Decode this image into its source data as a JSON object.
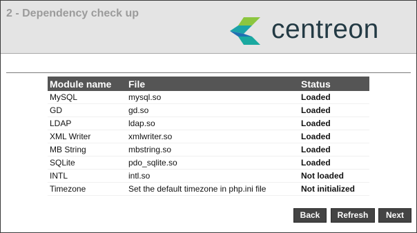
{
  "header": {
    "step_title": "2 - Dependency check up",
    "logo_text": "centreon"
  },
  "table": {
    "columns": [
      "Module name",
      "File",
      "Status"
    ],
    "rows": [
      {
        "module": "MySQL",
        "file": "mysql.so",
        "status": "Loaded",
        "state": "ok"
      },
      {
        "module": "GD",
        "file": "gd.so",
        "status": "Loaded",
        "state": "ok"
      },
      {
        "module": "LDAP",
        "file": "ldap.so",
        "status": "Loaded",
        "state": "ok"
      },
      {
        "module": "XML Writer",
        "file": "xmlwriter.so",
        "status": "Loaded",
        "state": "ok"
      },
      {
        "module": "MB String",
        "file": "mbstring.so",
        "status": "Loaded",
        "state": "ok"
      },
      {
        "module": "SQLite",
        "file": "pdo_sqlite.so",
        "status": "Loaded",
        "state": "ok"
      },
      {
        "module": "INTL",
        "file": "intl.so",
        "status": "Not loaded",
        "state": "bad"
      },
      {
        "module": "Timezone",
        "file": "Set the default timezone in php.ini file",
        "status": "Not initialized",
        "state": "bad"
      }
    ]
  },
  "buttons": {
    "back": "Back",
    "refresh": "Refresh",
    "next": "Next"
  },
  "colors": {
    "ok": "#19b419",
    "bad": "#ee1111",
    "logo_teal": "#1ba3a8",
    "logo_green": "#8cc63f",
    "logo_blue": "#1f6fb2",
    "logo_text": "#233a44"
  },
  "icons": {
    "logo_mark": "centreon-logo-icon"
  }
}
